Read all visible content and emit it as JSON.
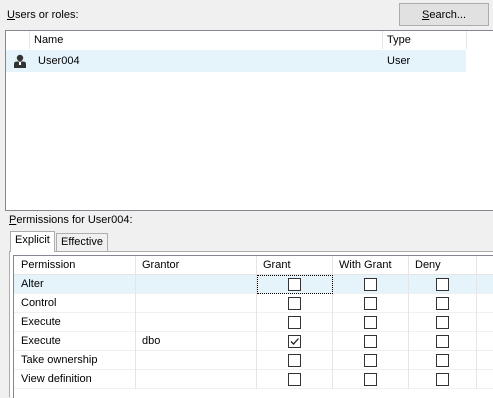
{
  "users_label_prefix": "U",
  "users_label_rest": "sers or roles:",
  "search_prefix": "S",
  "search_rest": "earch...",
  "users_list": {
    "columns": [
      "Name",
      "Type"
    ],
    "rows": [
      {
        "name": "User004",
        "type": "User",
        "icon": "user-icon"
      }
    ]
  },
  "permissions_label_prefix": "P",
  "permissions_label_rest": "ermissions for User004:",
  "tabs": [
    {
      "label": "Explicit",
      "active": true
    },
    {
      "label": "Effective",
      "active": false
    }
  ],
  "grid": {
    "columns": [
      "Permission",
      "Grantor",
      "Grant",
      "With Grant",
      "Deny"
    ],
    "rows": [
      {
        "permission": "Alter",
        "grantor": "",
        "grant": false,
        "with_grant": false,
        "deny": false
      },
      {
        "permission": "Control",
        "grantor": "",
        "grant": false,
        "with_grant": false,
        "deny": false
      },
      {
        "permission": "Execute",
        "grantor": "",
        "grant": false,
        "with_grant": false,
        "deny": false
      },
      {
        "permission": "Execute",
        "grantor": "dbo",
        "grant": true,
        "with_grant": false,
        "deny": false
      },
      {
        "permission": "Take ownership",
        "grantor": "",
        "grant": false,
        "with_grant": false,
        "deny": false
      },
      {
        "permission": "View definition",
        "grantor": "",
        "grant": false,
        "with_grant": false,
        "deny": false
      }
    ]
  },
  "colors": {
    "selection": "#e5f3fb",
    "window": "#f0f0f0"
  }
}
